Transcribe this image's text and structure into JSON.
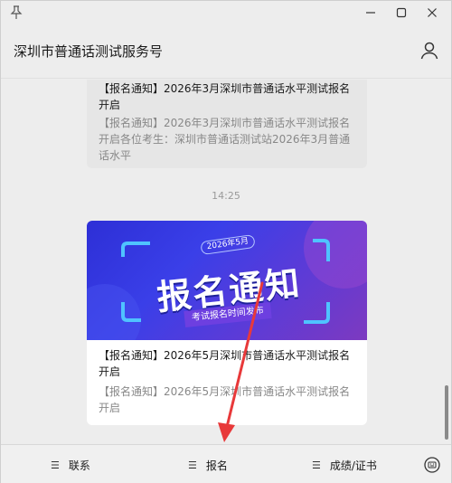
{
  "window": {
    "title": "深圳市普通话测试服务号",
    "controls": [
      "pin-icon",
      "minimize-icon",
      "maximize-icon",
      "close-icon"
    ]
  },
  "messages": [
    {
      "title": "【报名通知】2026年3月深圳市普通话水平测试报名开启",
      "desc": "【报名通知】2026年3月深圳市普通话水平测试报名开启各位考生：深圳市普通话测试站2026年3月普通话水平"
    },
    {
      "time": "14:25",
      "banner": {
        "date": "2026年5月",
        "title": "报名通知",
        "subtitle": "考试报名时间发布"
      },
      "title": "【报名通知】2026年5月深圳市普通话水平测试报名开启",
      "desc": "【报名通知】2026年5月深圳市普通话水平测试报名开启"
    }
  ],
  "menu": {
    "items": [
      {
        "label": "联系"
      },
      {
        "label": "报名"
      },
      {
        "label": "成绩/证书"
      }
    ]
  },
  "colors": {
    "accent_arrow": "#e8393a",
    "banner_start": "#2d2fd6",
    "banner_end": "#7d3ac0"
  }
}
